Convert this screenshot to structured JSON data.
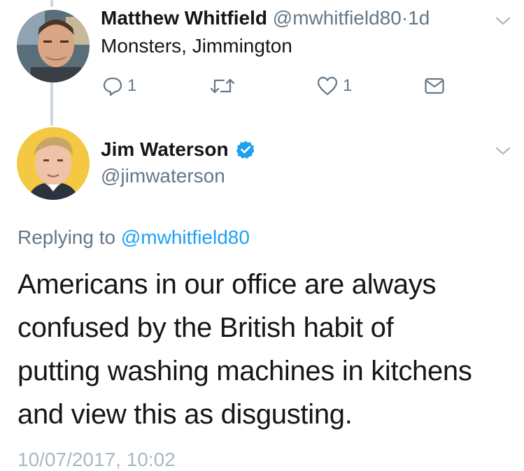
{
  "parent_tweet": {
    "author_name": "Matthew Whitfield",
    "author_handle": "@mwhitfield80",
    "separator": "·",
    "time_ago": "1d",
    "text": "Monsters, Jimmington",
    "reply_count": "1",
    "like_count": "1",
    "icons": [
      "reply-icon",
      "retweet-icon",
      "like-icon",
      "direct-message-icon",
      "chevron-down-icon"
    ]
  },
  "main_tweet": {
    "author_name": "Jim Waterson",
    "author_handle": "@jimwaterson",
    "verified": true,
    "replying_prefix": "Replying to",
    "replying_to": "@mwhitfield80",
    "body_lines": [
      "Americans in our office are always",
      "confused by the British habit of",
      "putting washing machines in kitchens",
      "and view this as disgusting."
    ],
    "timestamp": "10/07/2017, 10:02"
  },
  "colors": {
    "accent": "#1da1f2",
    "muted": "#657786",
    "thread_line": "#ccd6dd",
    "text": "#14171a"
  }
}
